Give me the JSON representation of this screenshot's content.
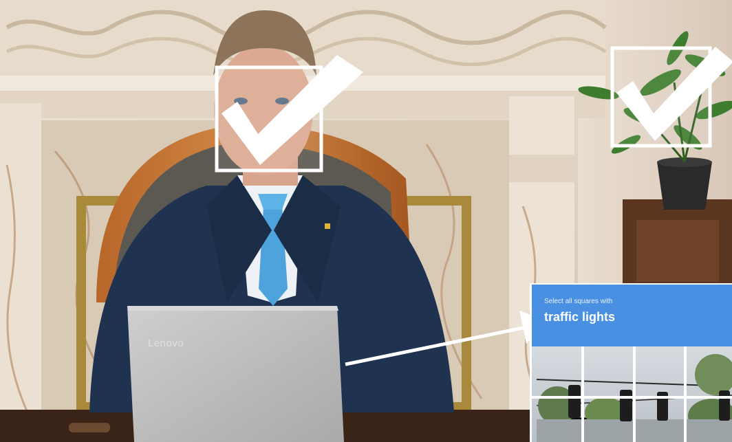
{
  "captcha": {
    "instruction": "Select all squares with",
    "target": "traffic lights"
  },
  "laptop": {
    "brand": "Lenovo"
  },
  "colors": {
    "captcha_blue": "#4a90e2",
    "suit": "#1f3350",
    "tie": "#4fa3dc",
    "laptop": "#b9b9b9"
  },
  "icons": [
    "checkmark-icon",
    "checkmark-icon",
    "arrow-icon"
  ]
}
